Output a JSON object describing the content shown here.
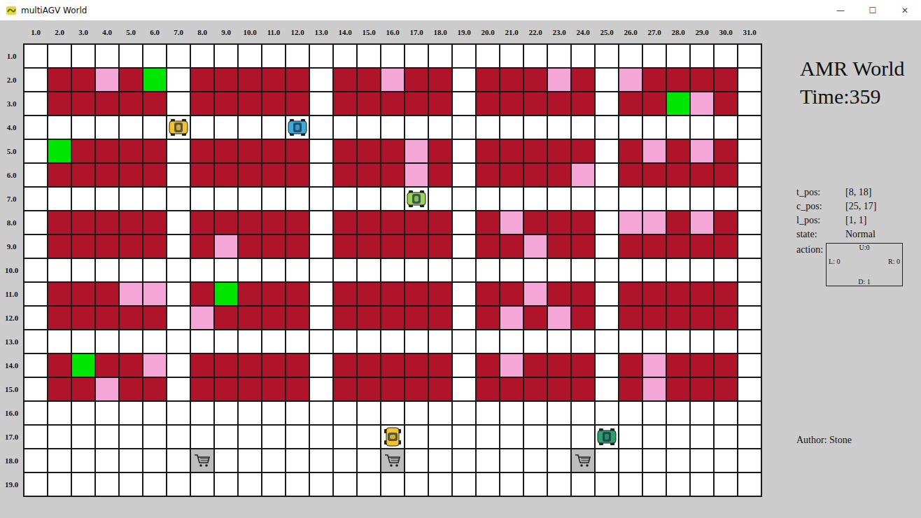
{
  "window": {
    "title": "multiAGV World",
    "controls": [
      "—",
      "☐",
      "✕"
    ]
  },
  "world": {
    "column_labels": [
      "1.0",
      "2.0",
      "3.0",
      "4.0",
      "5.0",
      "6.0",
      "7.0",
      "8.0",
      "9.0",
      "10.0",
      "11.0",
      "12.0",
      "13.0",
      "14.0",
      "15.0",
      "16.0",
      "17.0",
      "18.0",
      "19.0",
      "20.0",
      "21.0",
      "22.0",
      "23.0",
      "24.0",
      "25.0",
      "26.0",
      "27.0",
      "28.0",
      "29.0",
      "30.0",
      "31.0"
    ],
    "row_labels": [
      "1.0",
      "2.0",
      "3.0",
      "4.0",
      "5.0",
      "6.0",
      "7.0",
      "8.0",
      "9.0",
      "10.0",
      "11.0",
      "12.0",
      "13.0",
      "14.0",
      "15.0",
      "16.0",
      "17.0",
      "18.0",
      "19.0"
    ],
    "rows": [
      "...............................",
      ".RRPRG.RRRRR.RRPRR.RRRPR.PRRRR.",
      ".RRRRR.RRRRR.RRRRR.RRRRR.RRGPR.",
      "...............................",
      ".GRRRR.RRRRR.RRRPR.RRRRR.RPRPR.",
      ".RRRRR.RRRRR.RRRPR.RRRRP.RRRRR.",
      "...............................",
      ".RRRRR.RRRRR.RRRRR.RPRRR.PPRPR.",
      ".RRRRR.RPRRR.RRRRR.RRPRR.RRRRR.",
      "...............................",
      ".RRRPP.RGRRR.RRRRR.RRPRR.RRRRR.",
      ".RRRRR.PRRRR.RRRRR.RPRPR.RRRRR.",
      "...............................",
      ".RGRRP.RRRRR.RRRRR.RPRRR.RPRRR.",
      ".RRPRR.RRRRR.RRRRR.RRRRR.RPRRR.",
      "...............................",
      "...............................",
      ".......C.......C.......C.......",
      "..............................."
    ],
    "agvs": [
      {
        "row": 4,
        "col": 7,
        "color": "#f2c230",
        "orientation": "horizontal"
      },
      {
        "row": 4,
        "col": 12,
        "color": "#3fa9d8",
        "orientation": "horizontal"
      },
      {
        "row": 7,
        "col": 17,
        "color": "#9ad35a",
        "orientation": "horizontal"
      },
      {
        "row": 17,
        "col": 16,
        "color": "#f2c230",
        "orientation": "vertical"
      },
      {
        "row": 17,
        "col": 25,
        "color": "#2e9e6a",
        "orientation": "horizontal"
      }
    ]
  },
  "panel": {
    "title": "AMR World",
    "time": "Time:359",
    "info": [
      {
        "label": "t_pos:",
        "value": "[8, 18]"
      },
      {
        "label": "c_pos:",
        "value": "[25, 17]"
      },
      {
        "label": "l_pos:",
        "value": "[1, 1]"
      },
      {
        "label": "state:",
        "value": "Normal"
      }
    ],
    "action": {
      "label": "action:",
      "up": "U:0",
      "left": "L: 0",
      "right": "R: 0",
      "down": "D: 1"
    },
    "author": "Stone"
  },
  "author_label": "Author: Stone"
}
